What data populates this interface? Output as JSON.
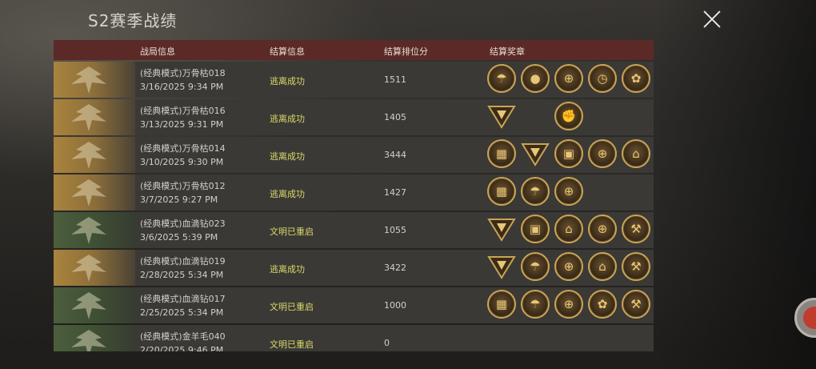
{
  "window": {
    "title": "S2赛季战绩",
    "close_icon": "close-icon"
  },
  "table": {
    "headers": {
      "match_info": "战局信息",
      "settle_info": "结算信息",
      "rank_score": "结算排位分",
      "medals": "结算奖章"
    },
    "rows": [
      {
        "name": "(经典模式)万骨枯018",
        "date": "3/16/2025 9:34 PM",
        "result": "逃离成功",
        "score": "1511",
        "theme": "gold",
        "medals": [
          "parachute-medal",
          "egg-medal",
          "helmet-medal",
          "stopwatch-medal",
          "wheat-medal"
        ]
      },
      {
        "name": "(经典模式)万骨枯016",
        "date": "3/13/2025 9:31 PM",
        "result": "逃离成功",
        "score": "1405",
        "theme": "gold",
        "medals": [
          "claw-triangle-medal",
          "",
          "fist-medal"
        ]
      },
      {
        "name": "(经典模式)万骨枯014",
        "date": "3/10/2025 9:30 PM",
        "result": "逃离成功",
        "score": "3444",
        "theme": "gold",
        "medals": [
          "map-medal",
          "eye-triangle-medal",
          "crate-medal",
          "helmet-medal",
          "tent-medal"
        ]
      },
      {
        "name": "(经典模式)万骨枯012",
        "date": "3/7/2025 9:27 PM",
        "result": "逃离成功",
        "score": "1427",
        "theme": "gold",
        "medals": [
          "map-medal",
          "parachute-medal",
          "helmet-medal"
        ]
      },
      {
        "name": "(经典模式)血滴钻023",
        "date": "3/6/2025 5:39 PM",
        "result": "文明已重启",
        "score": "1055",
        "theme": "green",
        "medals": [
          "claw-triangle-medal",
          "crate-medal",
          "tent-medal",
          "helmet-medal",
          "shovel-medal"
        ]
      },
      {
        "name": "(经典模式)血滴钻019",
        "date": "2/28/2025 5:34 PM",
        "result": "逃离成功",
        "score": "3422",
        "theme": "gold",
        "medals": [
          "claw-triangle-medal",
          "parachute-medal",
          "helmet-medal",
          "tent-medal",
          "shovel-medal"
        ]
      },
      {
        "name": "(经典模式)血滴钻017",
        "date": "2/25/2025 5:34 PM",
        "result": "文明已重启",
        "score": "1000",
        "theme": "green",
        "medals": [
          "map-medal",
          "parachute-medal",
          "helmet-medal",
          "wheat-medal",
          "shovel-medal"
        ]
      },
      {
        "name": "(经典模式)金羊毛040",
        "date": "2/20/2025 9:46 PM",
        "result": "文明已重启",
        "score": "0",
        "theme": "green",
        "medals": []
      }
    ]
  },
  "colors": {
    "header_bg": "#5c2a26",
    "result_text": "#d9d86a",
    "medal_gold": "#c9a459"
  }
}
